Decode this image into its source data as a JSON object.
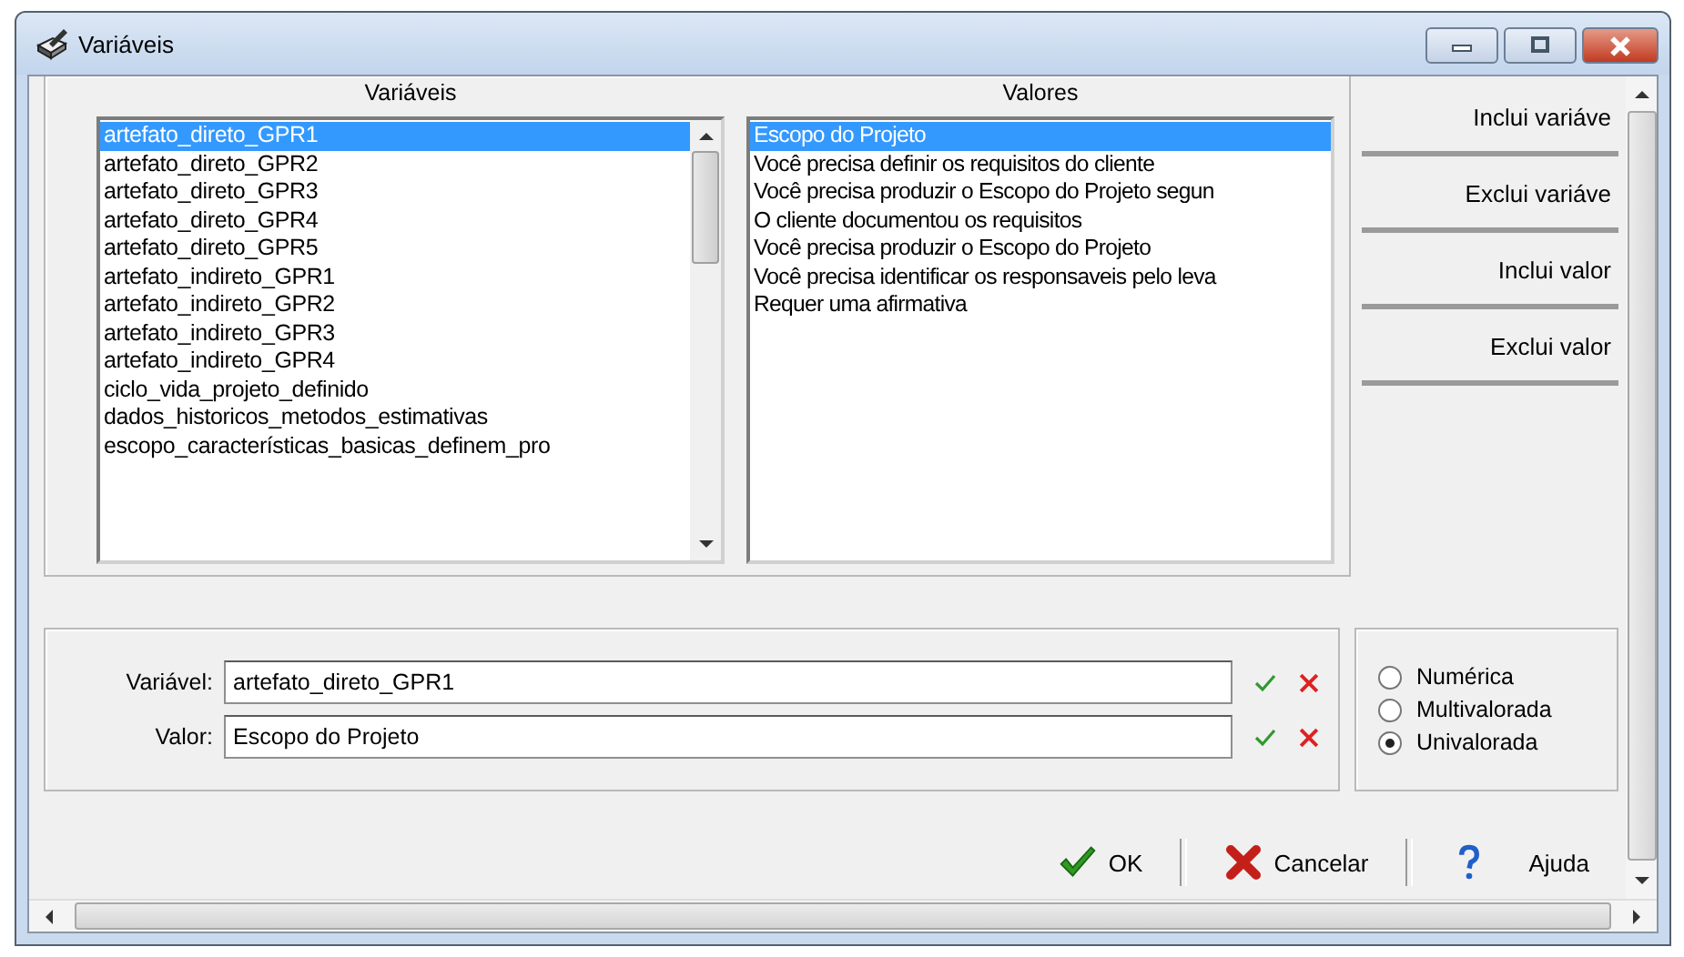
{
  "window": {
    "title": "Variáveis"
  },
  "variables_list": {
    "heading": "Variáveis",
    "items": [
      {
        "label": "artefato_direto_GPR1",
        "selected": true
      },
      {
        "label": "artefato_direto_GPR2",
        "selected": false
      },
      {
        "label": "artefato_direto_GPR3",
        "selected": false
      },
      {
        "label": "artefato_direto_GPR4",
        "selected": false
      },
      {
        "label": "artefato_direto_GPR5",
        "selected": false
      },
      {
        "label": "artefato_indireto_GPR1",
        "selected": false
      },
      {
        "label": "artefato_indireto_GPR2",
        "selected": false
      },
      {
        "label": "artefato_indireto_GPR3",
        "selected": false
      },
      {
        "label": "artefato_indireto_GPR4",
        "selected": false
      },
      {
        "label": "ciclo_vida_projeto_definido",
        "selected": false
      },
      {
        "label": "dados_historicos_metodos_estimativas",
        "selected": false
      },
      {
        "label": "escopo_características_basicas_definem_pro",
        "selected": false
      }
    ]
  },
  "values_list": {
    "heading": "Valores",
    "items": [
      {
        "label": "Escopo do Projeto",
        "selected": true
      },
      {
        "label": "Você precisa definir os requisitos do cliente",
        "selected": false
      },
      {
        "label": "Você precisa produzir o Escopo do Projeto segun",
        "selected": false
      },
      {
        "label": "O cliente documentou os requisitos",
        "selected": false
      },
      {
        "label": "Você precisa produzir o Escopo do Projeto",
        "selected": false
      },
      {
        "label": "Você precisa identificar os responsaveis pelo leva",
        "selected": false
      },
      {
        "label": "Requer uma afirmativa",
        "selected": false
      }
    ]
  },
  "side_buttons": [
    "Inclui variáve",
    "Exclui variáve",
    "Inclui valor",
    "Exclui valor"
  ],
  "fields": [
    {
      "label": "Variável:",
      "value": "artefato_direto_GPR1"
    },
    {
      "label": "Valor:",
      "value": "Escopo do Projeto"
    }
  ],
  "type_options": [
    {
      "label": "Numérica",
      "selected": false
    },
    {
      "label": "Multivalorada",
      "selected": false
    },
    {
      "label": "Univalorada",
      "selected": true
    }
  ],
  "buttons": [
    {
      "label": "OK",
      "kind": "ok"
    },
    {
      "label": "Cancelar",
      "kind": "cancel"
    },
    {
      "label": "Ajuda",
      "kind": "help"
    }
  ]
}
